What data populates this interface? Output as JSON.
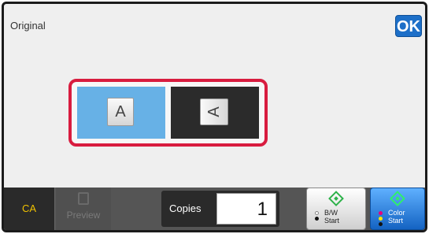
{
  "header": {
    "title": "Original",
    "ok_label": "OK"
  },
  "orientation": {
    "options": [
      {
        "glyph": "A",
        "state": "selected",
        "orientation": "portrait"
      },
      {
        "glyph": "A",
        "state": "unselected",
        "orientation": "landscape"
      }
    ]
  },
  "bottom_bar": {
    "ca_label": "CA",
    "preview_label": "Preview",
    "copies_label": "Copies",
    "copies_value": "1",
    "bw_start": {
      "line1": "B/W",
      "line2": "Start"
    },
    "color_start": {
      "line1": "Color",
      "line2": "Start"
    }
  },
  "colors": {
    "selected_option": "#67b1e6",
    "unselected_option": "#2b2b2b",
    "highlight_border": "#d81c3f",
    "ok_button": "#1d6fc8",
    "ca_text": "#f0c100",
    "start_green": "#2db24a"
  },
  "icons": {
    "preview": "preview-icon",
    "start": "start-diamond-icon"
  }
}
